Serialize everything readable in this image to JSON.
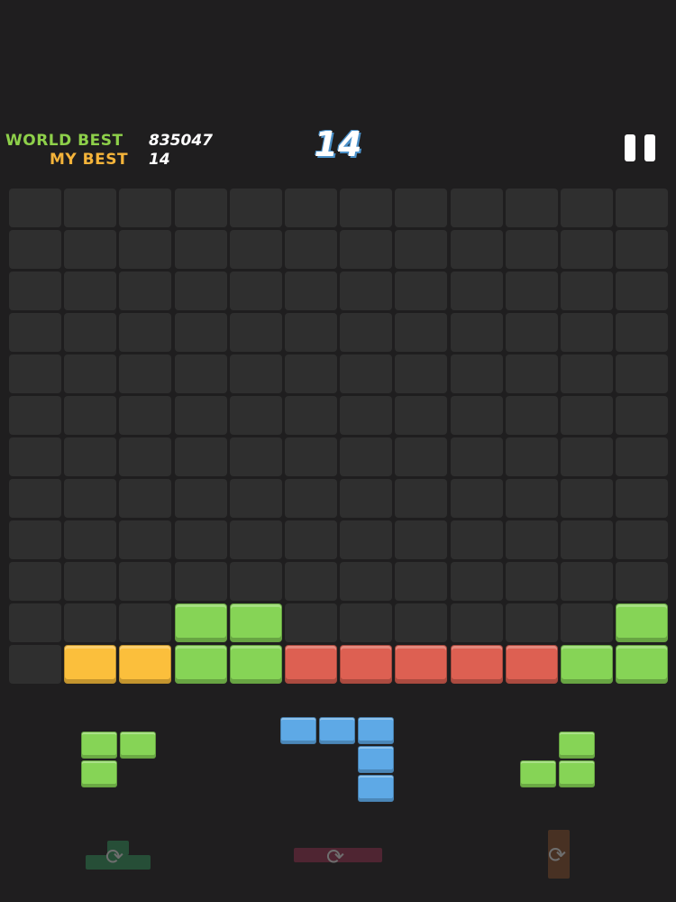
{
  "hud": {
    "world_best_label": "WORLD BEST",
    "world_best_value": "835047",
    "my_best_label": "MY BEST",
    "my_best_value": "14",
    "score": "14"
  },
  "colors": {
    "world_best_label": "#8ed04a",
    "my_best_label": "#f5b43a",
    "empty": "#2f2f2f",
    "G": "#86d456",
    "Y": "#fbbf3c",
    "R": "#dd6052",
    "B": "#5ea9e6"
  },
  "icons": {
    "pause": "pause-icon",
    "rotate": "rotate-icon"
  },
  "board": {
    "cols": 12,
    "rows": 12,
    "grid": [
      "............",
      "............",
      "............",
      "............",
      "............",
      "............",
      "............",
      "............",
      "............",
      "............",
      "...GG......G",
      ".YYGGRRRRRGG"
    ]
  },
  "pieces": [
    {
      "name": "piece-green-corner",
      "color": "G",
      "shape": [
        "XX",
        "X."
      ]
    },
    {
      "name": "piece-blue-hook",
      "color": "B",
      "shape": [
        "XXX",
        "..X",
        "..X"
      ]
    },
    {
      "name": "piece-green-small-l",
      "color": "G",
      "shape": [
        ".X",
        "XX"
      ]
    }
  ]
}
